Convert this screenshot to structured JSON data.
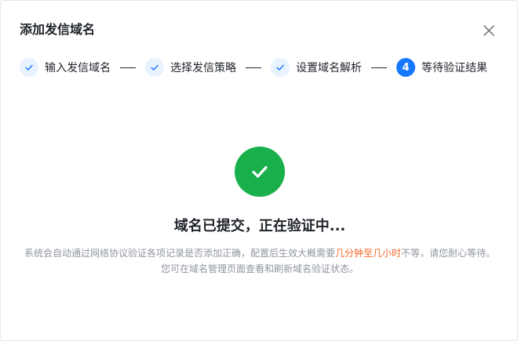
{
  "dialog": {
    "title": "添加发信域名",
    "close_icon": "close-icon"
  },
  "steps": [
    {
      "label": "输入发信域名",
      "status": "done",
      "icon": "check-icon"
    },
    {
      "label": "选择发信策略",
      "status": "done",
      "icon": "check-icon"
    },
    {
      "label": "设置域名解析",
      "status": "done",
      "icon": "check-icon"
    },
    {
      "label": "等待验证结果",
      "status": "active",
      "number": "4"
    }
  ],
  "result": {
    "icon": "check-circle-icon",
    "icon_color": "#19b04b",
    "title": "域名已提交，正在验证中...",
    "desc_part1": "系统会自动通过网络协议验证各项记录是否添加正确，配置后生效大概需要",
    "desc_highlight": "几分钟至几小时",
    "desc_part2": "不等，请您耐心等待。您可在域名管理页面查看和刷新域名验证状态。",
    "highlight_color": "#f5692b"
  },
  "colors": {
    "primary": "#1677ff",
    "step_done_bg": "#e8f3ff",
    "text_primary": "#1f2329",
    "text_secondary": "#8f959e"
  }
}
